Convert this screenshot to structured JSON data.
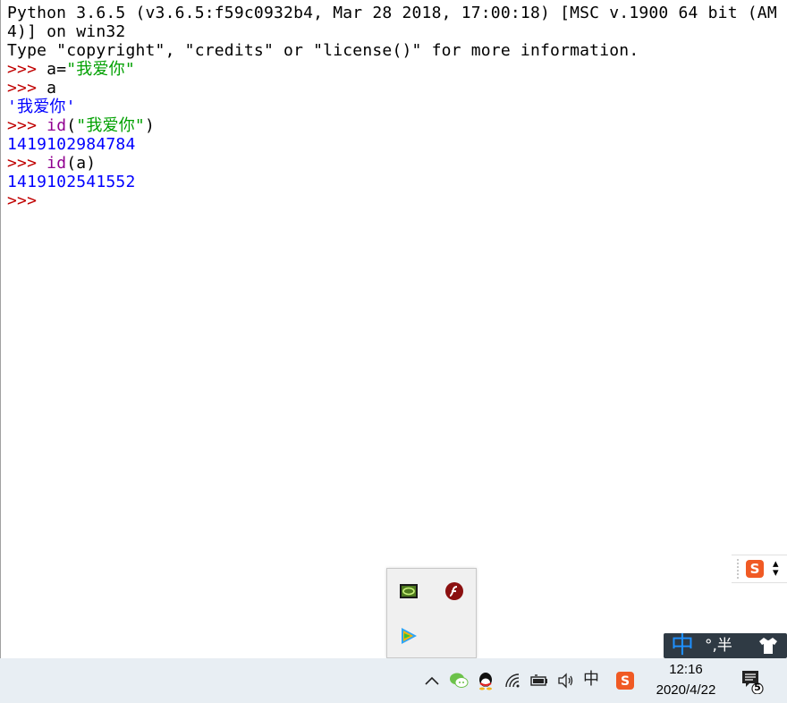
{
  "console": {
    "banner_line1": "Python 3.6.5 (v3.6.5:f59c0932b4, Mar 28 2018, 17:00:18) [MSC v.1900 64 bit (AM",
    "banner_line2": "4)] on win32",
    "banner_line3": "Type \"copyright\", \"credits\" or \"license()\" for more information.",
    "prompt": ">>> ",
    "entries": [
      {
        "code_prefix": "a=",
        "code_string": "\"我爱你\""
      },
      {
        "code": "a"
      },
      {
        "result": "'我爱你'"
      },
      {
        "builtin": "id",
        "open": "(",
        "code_string": "\"我爱你\"",
        "close": ")"
      },
      {
        "result": "1419102984784"
      },
      {
        "builtin": "id",
        "rest": "(a)"
      },
      {
        "result": "1419102541552"
      }
    ]
  },
  "ime": {
    "mode_char": "中",
    "status_text": "°,半",
    "logo_letter": "S"
  },
  "taskbar": {
    "tray_lang": "中",
    "clock_time": "12:16",
    "clock_date": "2020/4/22",
    "notification_count": "5"
  },
  "colors": {
    "prompt": "#c00000",
    "string": "#00a000",
    "builtin": "#900090",
    "result": "#0000ff"
  }
}
